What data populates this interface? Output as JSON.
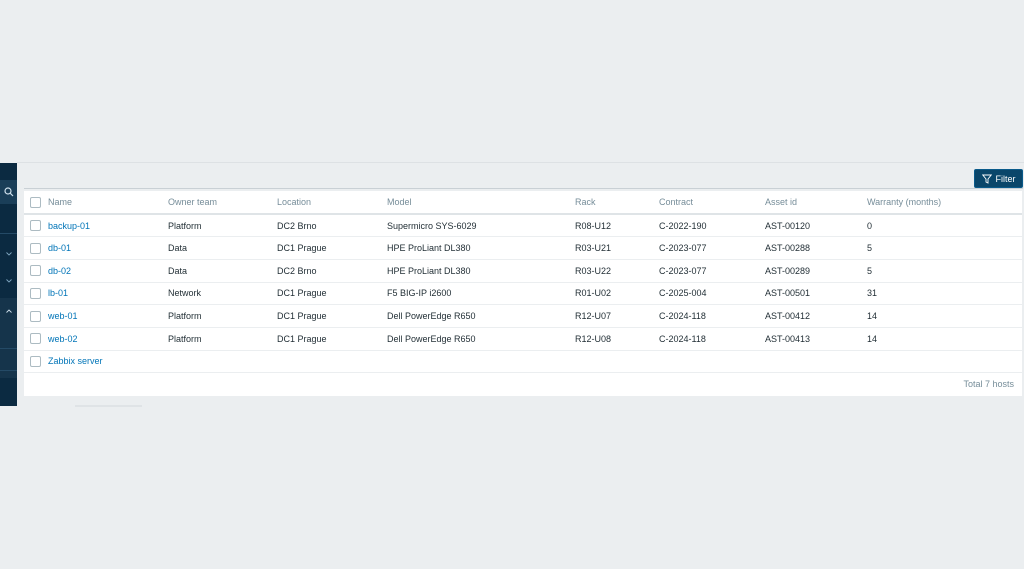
{
  "filter": {
    "label": "Filter"
  },
  "table": {
    "columns": [
      "Name",
      "Owner team",
      "Location",
      "Model",
      "Rack",
      "Contract",
      "Asset id",
      "Warranty (months)"
    ],
    "rows": [
      [
        "backup-01",
        "Platform",
        "DC2 Brno",
        "Supermicro SYS-6029",
        "R08-U12",
        "C-2022-190",
        "AST-00120",
        "0"
      ],
      [
        "db-01",
        "Data",
        "DC1 Prague",
        "HPE ProLiant DL380",
        "R03-U21",
        "C-2023-077",
        "AST-00288",
        "5"
      ],
      [
        "db-02",
        "Data",
        "DC2 Brno",
        "HPE ProLiant DL380",
        "R03-U22",
        "C-2023-077",
        "AST-00289",
        "5"
      ],
      [
        "lb-01",
        "Network",
        "DC1 Prague",
        "F5 BIG-IP i2600",
        "R01-U02",
        "C-2025-004",
        "AST-00501",
        "31"
      ],
      [
        "web-01",
        "Platform",
        "DC1 Prague",
        "Dell PowerEdge R650",
        "R12-U07",
        "C-2024-118",
        "AST-00412",
        "14"
      ],
      [
        "web-02",
        "Platform",
        "DC1 Prague",
        "Dell PowerEdge R650",
        "R12-U08",
        "C-2024-118",
        "AST-00413",
        "14"
      ],
      [
        "Zabbix server",
        "",
        "",
        "",
        "",
        "",
        "",
        ""
      ]
    ],
    "footer": "Total 7 hosts"
  },
  "icons": {
    "filter": "filter-funnel-icon",
    "search": "search-icon",
    "expand": "chevron-down-icon",
    "collapse": "chevron-up-icon"
  },
  "colors": {
    "link": "#0275b8",
    "sidebar": "#0b2a41",
    "filter_button": "#0a466a",
    "background": "#ebeef0"
  }
}
